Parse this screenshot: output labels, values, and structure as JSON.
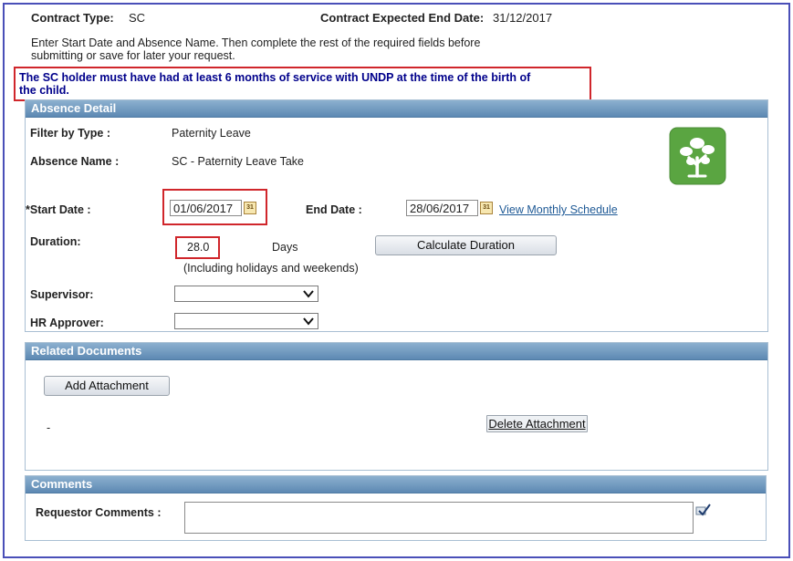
{
  "header": {
    "contract_type_label": "Contract Type:",
    "contract_type_value": "SC",
    "contract_end_label": "Contract Expected End Date:",
    "contract_end_value": "31/12/2017",
    "instruction_line1": "Enter Start Date and Absence Name. Then complete the rest of the required fields before",
    "instruction_line2": "submitting or save for later your request.",
    "warning_line1": "The SC holder must have had at least 6 months of service with UNDP at the time of the birth of",
    "warning_line2": "the child."
  },
  "absence_detail": {
    "title": "Absence Detail",
    "filter_label": "Filter by Type :",
    "filter_value": "Paternity Leave",
    "absence_name_label": "Absence Name :",
    "absence_name_value": "SC - Paternity Leave Take",
    "start_date_label": "*Start Date :",
    "start_date_value": "01/06/2017",
    "end_date_label": "End Date :",
    "end_date_value": "28/06/2017",
    "calendar_icon_text": "31",
    "view_schedule_link": "View Monthly Schedule",
    "duration_label": "Duration:",
    "duration_value": "28.0",
    "duration_unit": "Days",
    "duration_note": "(Including holidays and weekends)",
    "calculate_button": "Calculate Duration",
    "supervisor_label": "Supervisor:",
    "supervisor_value": "",
    "hr_approver_label": "HR Approver:",
    "hr_approver_value": ""
  },
  "related_documents": {
    "title": "Related Documents",
    "add_attachment_button": "Add Attachment",
    "attachment_placeholder": "-",
    "delete_attachment_button": "Delete Attachment"
  },
  "comments": {
    "title": "Comments",
    "requestor_label": "Requestor Comments :",
    "requestor_value": ""
  },
  "colors": {
    "frame_border": "#4a4fb8",
    "highlight_box": "#d0262b",
    "warning_text": "#00008b",
    "panel_header": "#6f97bd",
    "tree_tile": "#5aa541"
  },
  "icons": [
    "tree-logo-icon",
    "calendar-icon",
    "chevron-down-icon",
    "spell-check-icon"
  ]
}
